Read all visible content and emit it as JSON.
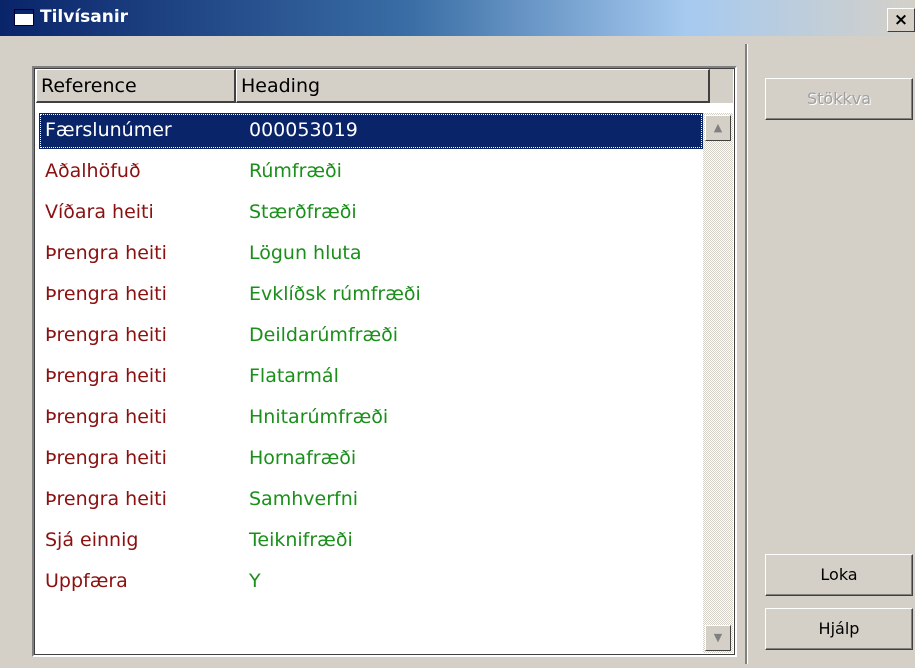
{
  "window": {
    "title": "Tilvísanir",
    "close_label": "×"
  },
  "list": {
    "columns": [
      "Reference",
      "Heading"
    ],
    "rows": [
      {
        "reference": "Færslunúmer",
        "heading": "000053019"
      },
      {
        "reference": "Aðalhöfuð",
        "heading": "Rúmfræði"
      },
      {
        "reference": "Víðara heiti",
        "heading": "Stærðfræði"
      },
      {
        "reference": "Þrengra heiti",
        "heading": "Lögun hluta"
      },
      {
        "reference": "Þrengra heiti",
        "heading": "Evklíðsk rúmfræði"
      },
      {
        "reference": "Þrengra heiti",
        "heading": "Deildarúmfræði"
      },
      {
        "reference": "Þrengra heiti",
        "heading": "Flatarmál"
      },
      {
        "reference": "Þrengra heiti",
        "heading": "Hnitarúmfræði"
      },
      {
        "reference": "Þrengra heiti",
        "heading": "Hornafræði"
      },
      {
        "reference": "Þrengra heiti",
        "heading": "Samhverfni"
      },
      {
        "reference": "Sjá einnig",
        "heading": "Teiknifræði"
      },
      {
        "reference": "Uppfæra",
        "heading": "Y"
      }
    ],
    "selected_index": 0,
    "scroll_up_label": "▲",
    "scroll_down_label": "▼"
  },
  "buttons": {
    "jump": "Stökkva",
    "close": "Loka",
    "help": "Hjálp"
  },
  "colors": {
    "reference_text": "#8b1010",
    "heading_text": "#1a8f1a",
    "selection": "#0a246a"
  }
}
